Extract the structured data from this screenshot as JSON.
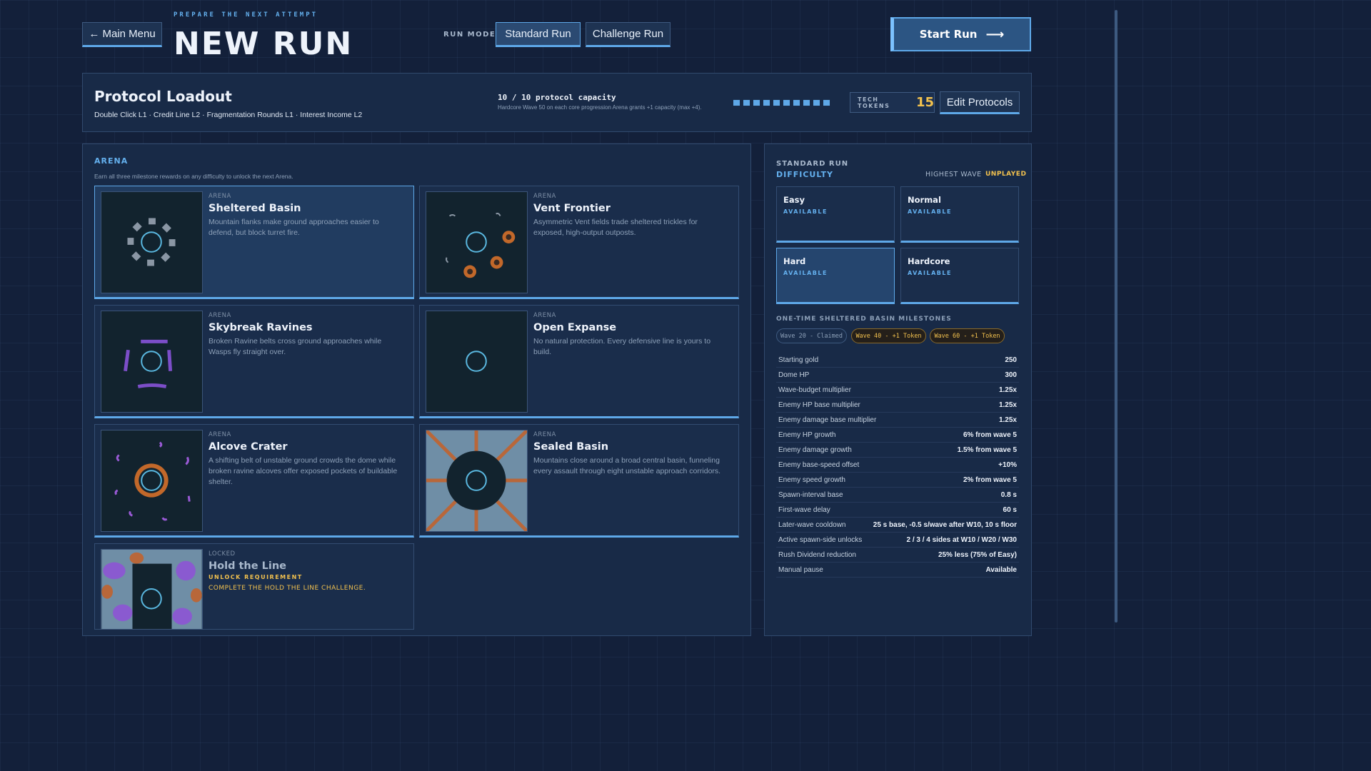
{
  "header": {
    "eyebrow": "PREPARE THE NEXT ATTEMPT",
    "title": "NEW RUN",
    "back_label": "← Main Menu",
    "run_mode_label": "RUN MODE",
    "modes": [
      "Standard Run",
      "Challenge Run"
    ],
    "selected_mode": "Standard Run",
    "start_label": "Start Run",
    "start_arrow": "⟶"
  },
  "loadout": {
    "title": "Protocol Loadout",
    "protocols": "Double Click L1 · Credit Line L2 · Fragmentation Rounds L1 · Interest Income L2",
    "capacity": "10 / 10 protocol capacity",
    "capacity_note": "Hardcore Wave 50 on each core progression Arena grants +1 capacity (max +4).",
    "capacity_used": 10,
    "capacity_max": 10,
    "tokens_label": "TECH TOKENS",
    "tokens_value": "15",
    "edit_label": "Edit Protocols"
  },
  "arena": {
    "heading": "ARENA",
    "subtitle": "Earn all three milestone rewards on any difficulty to unlock the next Arena.",
    "cards": [
      {
        "tag": "ARENA",
        "name": "Sheltered Basin",
        "desc": "Mountain flanks make ground approaches easier to defend, but block turret fire.",
        "selected": true
      },
      {
        "tag": "ARENA",
        "name": "Vent Frontier",
        "desc": "Asymmetric Vent fields trade sheltered trickles for exposed, high-output outposts."
      },
      {
        "tag": "ARENA",
        "name": "Skybreak Ravines",
        "desc": "Broken Ravine belts cross ground approaches while Wasps fly straight over."
      },
      {
        "tag": "ARENA",
        "name": "Open Expanse",
        "desc": "No natural protection. Every defensive line is yours to build."
      },
      {
        "tag": "ARENA",
        "name": "Alcove Crater",
        "desc": "A shifting belt of unstable ground crowds the dome while broken ravine alcoves offer exposed pockets of buildable shelter."
      },
      {
        "tag": "ARENA",
        "name": "Sealed Basin",
        "desc": "Mountains close around a broad central basin, funneling every assault through eight unstable approach corridors."
      },
      {
        "tag": "LOCKED",
        "name": "Hold the Line",
        "req_label": "UNLOCK REQUIREMENT",
        "req_text": "COMPLETE THE HOLD THE LINE CHALLENGE."
      }
    ]
  },
  "difficulty": {
    "heading_a": "STANDARD RUN",
    "heading_b": "DIFFICULTY",
    "highest_wave_label": "HIGHEST WAVE",
    "highest_wave_value": "UNPLAYED",
    "options": [
      {
        "name": "Easy",
        "status": "AVAILABLE"
      },
      {
        "name": "Normal",
        "status": "AVAILABLE"
      },
      {
        "name": "Hard",
        "status": "AVAILABLE",
        "selected": true
      },
      {
        "name": "Hardcore",
        "status": "AVAILABLE"
      }
    ],
    "milestones_heading": "ONE-TIME SHELTERED BASIN MILESTONES",
    "milestones": [
      "Wave 20 - Claimed",
      "Wave 40 - +1 Token",
      "Wave 60 - +1 Token"
    ],
    "stats": [
      {
        "k": "Starting gold",
        "v": "250"
      },
      {
        "k": "Dome HP",
        "v": "300"
      },
      {
        "k": "Wave-budget multiplier",
        "v": "1.25x"
      },
      {
        "k": "Enemy HP base multiplier",
        "v": "1.25x"
      },
      {
        "k": "Enemy damage base multiplier",
        "v": "1.25x"
      },
      {
        "k": "Enemy HP growth",
        "v": "6% from wave 5"
      },
      {
        "k": "Enemy damage growth",
        "v": "1.5% from wave 5"
      },
      {
        "k": "Enemy base-speed offset",
        "v": "+10%"
      },
      {
        "k": "Enemy speed growth",
        "v": "2% from wave 5"
      },
      {
        "k": "Spawn-interval base",
        "v": "0.8 s"
      },
      {
        "k": "First-wave delay",
        "v": "60 s"
      },
      {
        "k": "Later-wave cooldown",
        "v": "25 s base, -0.5 s/wave after W10, 10 s floor"
      },
      {
        "k": "Active spawn-side unlocks",
        "v": "2 / 3 / 4 sides at W10 / W20 / W30"
      },
      {
        "k": "Rush Dividend reduction",
        "v": "25% less (75% of Easy)"
      },
      {
        "k": "Manual pause",
        "v": "Available"
      }
    ]
  },
  "colors": {
    "accent": "#5ea8e8",
    "gold": "#f2c14e",
    "panel": "#182a47",
    "bg": "#13203a"
  }
}
